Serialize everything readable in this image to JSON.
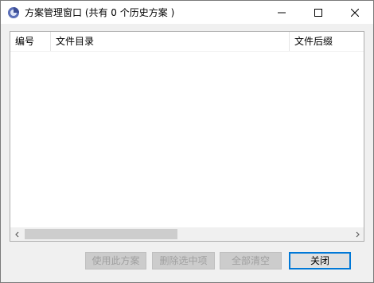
{
  "window": {
    "title": "方案管理窗口 (共有 0 个历史方案 )"
  },
  "list": {
    "columns": [
      "编号",
      "文件目录",
      "文件后缀"
    ],
    "rows": []
  },
  "buttons": {
    "use": "使用此方案",
    "delete_selected": "删除选中项",
    "clear_all": "全部清空",
    "close": "关闭"
  },
  "icons": {
    "app": "app-icon",
    "minimize": "minimize-icon",
    "maximize": "maximize-icon",
    "close": "close-icon",
    "scroll_left": "chevron-left-icon",
    "scroll_right": "chevron-right-icon"
  }
}
